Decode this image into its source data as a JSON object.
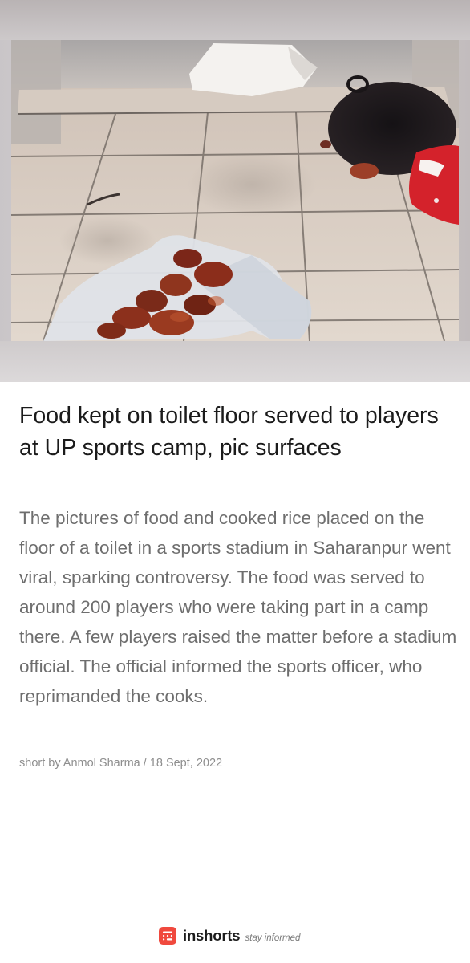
{
  "article": {
    "headline": "Food kept on toilet floor served to players at UP sports camp, pic surfaces",
    "body": "The pictures of food and cooked rice placed on the floor of a toilet in a sports stadium in Saharanpur went viral, sparking controversy. The food was served to around 200 players who were taking part in a camp there. A few players raised the matter before a stadium official. The official informed the sports officer, who reprimanded the cooks.",
    "byline": "short by Anmol Sharma / 18 Sept, 2022"
  },
  "image": {
    "subject": "tiled floor with food placed on a white sheet, a black wok and a red cloth"
  },
  "footer": {
    "brand_name": "inshorts",
    "tagline": "stay informed",
    "logo_icon": "inshorts-logo-icon"
  },
  "colors": {
    "brand": "#f0493e",
    "headline": "#1b1b1b",
    "body": "#6e6e6e",
    "byline": "#8e8e8e"
  }
}
